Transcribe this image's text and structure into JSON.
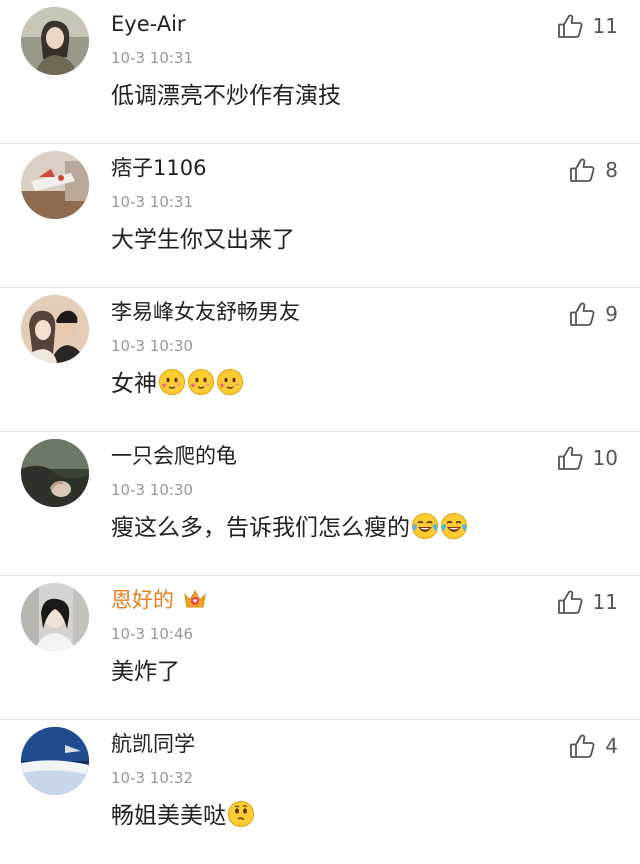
{
  "comments": [
    {
      "username": "Eye-Air",
      "vip": false,
      "timestamp": "10-3 10:31",
      "text": "低调漂亮不炒作有演技",
      "emojis": [],
      "likes": "11",
      "avatar_color": "#6b6b5f"
    },
    {
      "username": "痞子1106",
      "vip": false,
      "timestamp": "10-3 10:31",
      "text": "大学生你又出来了",
      "emojis": [],
      "likes": "8",
      "avatar_color": "#b89a84"
    },
    {
      "username": "李易峰女友舒畅男友",
      "vip": false,
      "timestamp": "10-3 10:30",
      "text": "女神",
      "emojis": [
        "love-face",
        "love-face",
        "love-face"
      ],
      "likes": "9",
      "avatar_color": "#c8a48c"
    },
    {
      "username": "一只会爬的龟",
      "vip": false,
      "timestamp": "10-3 10:30",
      "text": "瘦这么多，告诉我们怎么瘦的",
      "emojis": [
        "laugh-cry",
        "laugh-cry"
      ],
      "likes": "10",
      "avatar_color": "#4a5244"
    },
    {
      "username": "恩好的",
      "vip": true,
      "timestamp": "10-3 10:46",
      "text": "美炸了",
      "emojis": [],
      "likes": "11",
      "avatar_color": "#d8d4cf"
    },
    {
      "username": "航凯同学",
      "vip": false,
      "timestamp": "10-3 10:32",
      "text": "畅姐美美哒",
      "emojis": [
        "thinking-face"
      ],
      "likes": "4",
      "avatar_color": "#1f3c6e"
    }
  ],
  "colors": {
    "vip_name": "#eb7f1f",
    "meta": "#999999",
    "divider": "#e6e6e6"
  }
}
